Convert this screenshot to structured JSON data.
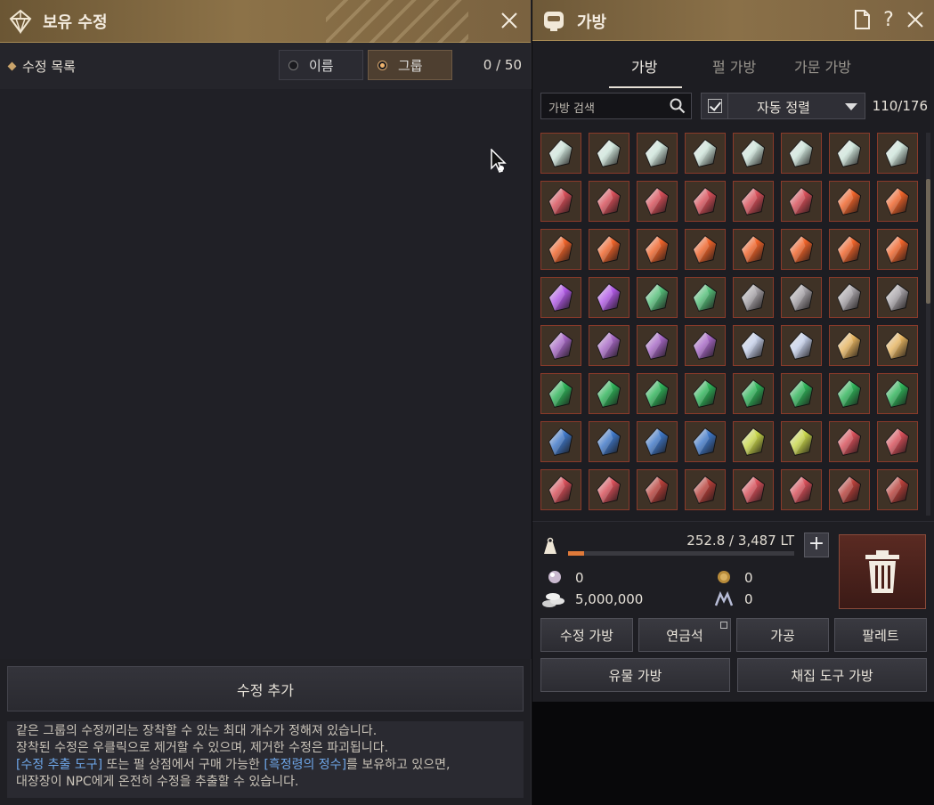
{
  "left": {
    "title": "보유 수정",
    "list_label": "수정 목록",
    "radio_name": "이름",
    "radio_group": "그룹",
    "count": "0 / 50",
    "add_button": "수정 추가",
    "notice": {
      "line1": "같은 그룹의 수정끼리는 장착할 수 있는 최대 개수가 정해져 있습니다.",
      "line2": "장착된 수정은 우클릭으로 제거할 수 있으며, 제거한 수정은 파괴됩니다.",
      "line3_hl1": "[수정 추출 도구]",
      "line3_mid": " 또는 펄 상점에서 구매 가능한 ",
      "line3_hl2": "[흑정령의 정수]",
      "line3_end": "를 보유하고 있으면,",
      "line4": "대장장이 NPC에게 온전히 수정을 추출할 수 있습니다."
    }
  },
  "right": {
    "title": "가방",
    "tabs": [
      "가방",
      "펄 가방",
      "가문 가방"
    ],
    "search_placeholder": "가방 검색",
    "sort_label": "자동 정렬",
    "bag_count": "110/176",
    "weight": "252.8 / 3,487 LT",
    "weight_fraction": 0.072,
    "currency": {
      "pearl": "0",
      "silver": "5,000,000",
      "coin": "0",
      "m": "0"
    },
    "buttons": [
      "수정 가방",
      "연금석",
      "가공",
      "팔레트",
      "유물 가방",
      "채집 도구 가방"
    ]
  },
  "grid_rows": [
    [
      "white",
      "white",
      "white",
      "white",
      "white",
      "white",
      "white",
      "white"
    ],
    [
      "red",
      "red",
      "red",
      "red",
      "red",
      "red",
      "orange",
      "orange"
    ],
    [
      "orange",
      "orange",
      "orange",
      "orange",
      "orange",
      "orange",
      "orange",
      "orange"
    ],
    [
      "purple",
      "purple",
      "emerald",
      "emerald",
      "gray",
      "gray",
      "gray",
      "gray"
    ],
    [
      "violet",
      "violet",
      "violet",
      "violet",
      "silver",
      "silver",
      "gold",
      "gold"
    ],
    [
      "green",
      "green",
      "green",
      "green",
      "green",
      "green",
      "green",
      "green"
    ],
    [
      "blue",
      "blue",
      "blue",
      "blue",
      "yellow",
      "yellow",
      "red",
      "red"
    ],
    [
      "red",
      "red",
      "darkred",
      "darkred",
      "red",
      "red",
      "darkred",
      "darkred"
    ]
  ],
  "colors": {
    "white": "#cfe6dc",
    "red": "#d8505a",
    "orange": "#f0642a",
    "purple": "#b25ae8",
    "emerald": "#55c07a",
    "gray": "#a7a3a8",
    "violet": "#a768c6",
    "silver": "#c5d0ea",
    "gold": "#e6b460",
    "green": "#2fb55a",
    "blue": "#3f78c8",
    "yellow": "#c8d64a",
    "darkred": "#b8403a"
  }
}
